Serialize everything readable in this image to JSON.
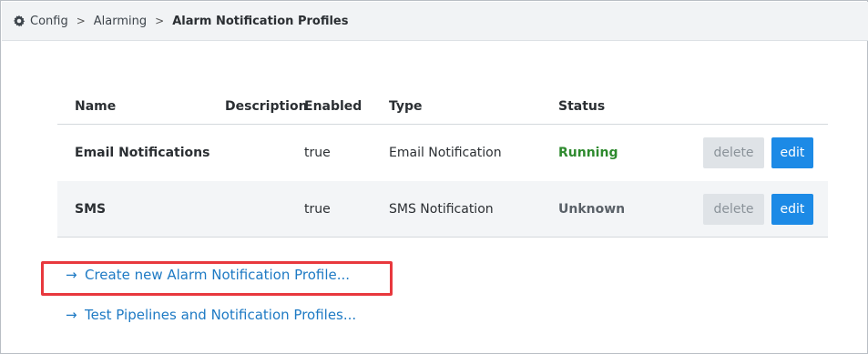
{
  "breadcrumb": {
    "icon": "gear-icon",
    "items": [
      "Config",
      "Alarming"
    ],
    "separator": ">",
    "current": "Alarm Notification Profiles"
  },
  "table": {
    "columns": {
      "name": "Name",
      "description": "Description",
      "enabled": "Enabled",
      "type": "Type",
      "status": "Status"
    },
    "rows": [
      {
        "name": "Email Notifications",
        "description": "",
        "enabled": "true",
        "type": "Email Notification",
        "status": "Running",
        "delete_label": "delete",
        "edit_label": "edit"
      },
      {
        "name": "SMS",
        "description": "",
        "enabled": "true",
        "type": "SMS Notification",
        "status": "Unknown",
        "delete_label": "delete",
        "edit_label": "edit"
      }
    ]
  },
  "actions": {
    "create_label": "Create new Alarm Notification Profile...",
    "test_label": "Test Pipelines and Notification Profiles...",
    "arrow": "→"
  },
  "colors": {
    "running": "#2e8a2e",
    "edit_button": "#1c8ae6",
    "link": "#1e7ac4",
    "highlight": "#e8383d"
  }
}
